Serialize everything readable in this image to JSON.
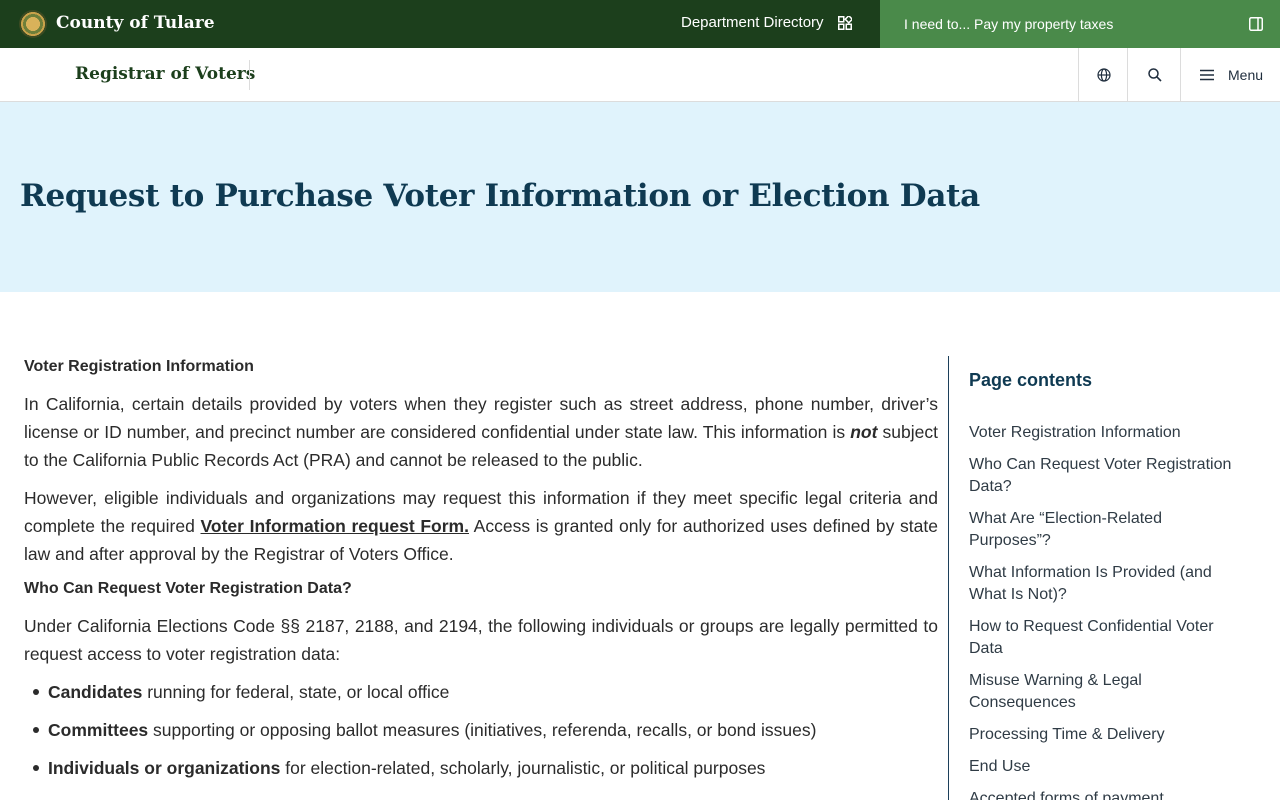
{
  "topbar": {
    "county_name": "County of Tulare",
    "department_directory": "Department Directory",
    "i_need_to": "I need to... Pay my property taxes"
  },
  "subheader": {
    "site_name": "Registrar of Voters",
    "menu_label": "Menu"
  },
  "hero": {
    "title": "Request to Purchase Voter Information or Election Data"
  },
  "main": {
    "heading_1": "Voter Registration Information",
    "p1_a": "In California, certain details provided by voters when they register such as street address, phone number, driver’s license or ID number, and precinct number are considered confidential under state law. This information is ",
    "p1_em": "not",
    "p1_b": " subject to the California Public Records Act (PRA) and cannot be released to the public.",
    "p2_a": "However, eligible individuals and organizations may request this information if they meet specific legal criteria and complete the required ",
    "p2_link": "Voter Information request Form.",
    "p2_b": " Access is granted only for authorized uses defined by state law and after approval by the Registrar of Voters Office.",
    "heading_2": "Who Can Request Voter Registration Data?",
    "p3": "Under California Elections Code §§ 2187, 2188, and 2194, the following individuals or groups are legally permitted to request access to voter registration data:",
    "list": [
      {
        "bold": "Candidates",
        "text": " running for federal, state, or local office"
      },
      {
        "bold": "Committees",
        "text": " supporting or opposing ballot measures (initiatives, referenda, recalls, or bond issues)"
      },
      {
        "bold": "Individuals or organizations",
        "text": " for election-related, scholarly, journalistic, or political purposes"
      }
    ]
  },
  "sidebar": {
    "title": "Page contents",
    "items": [
      "Voter Registration Information",
      "Who Can Request Voter Registration Data?",
      "What Are “Election-Related Purposes”?",
      "What Information Is Provided (and What Is Not)?",
      "How to Request Confidential Voter Data",
      "Misuse Warning & Legal Consequences",
      "Processing Time & Delivery",
      "End Use",
      "Accepted forms of payment"
    ]
  },
  "colors": {
    "topbar_dark_green": "#1c3f1c",
    "topbar_light_green": "#4a8a4a",
    "hero_background": "#e0f3fc",
    "title_navy": "#0f3a52"
  }
}
